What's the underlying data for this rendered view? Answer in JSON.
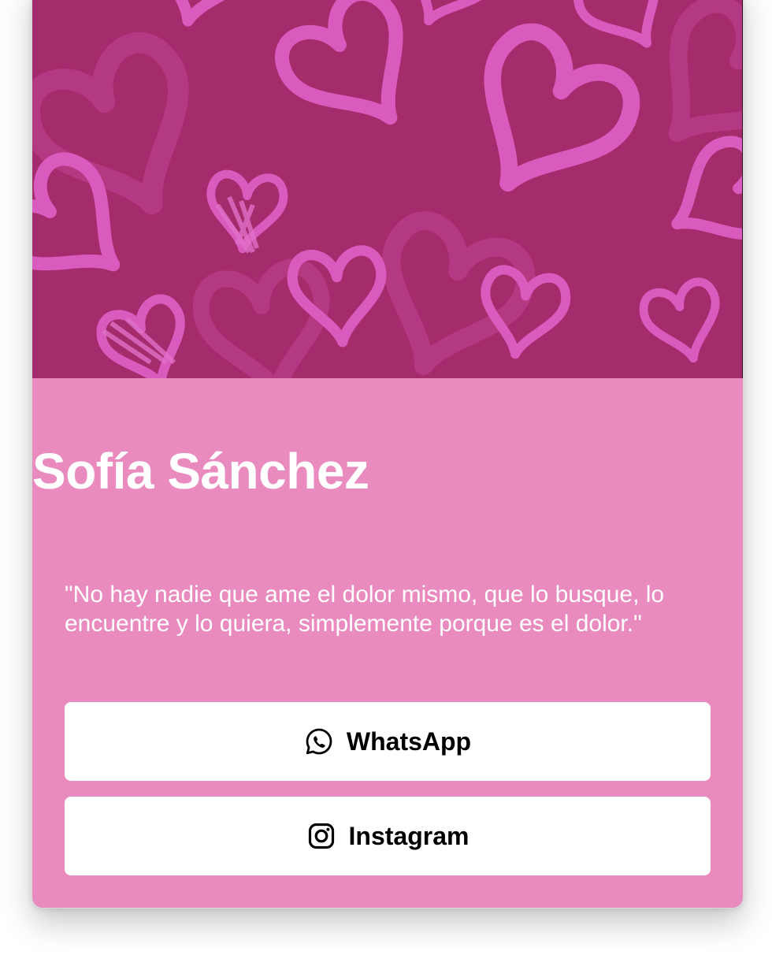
{
  "profile": {
    "name": "Sofía Sánchez",
    "quote": "\"No hay nadie que ame el dolor mismo, que lo busque, lo encuentre y lo quiera, simplemente porque es el dolor.\""
  },
  "links": {
    "whatsapp": {
      "label": "WhatsApp",
      "icon": "whatsapp-icon"
    },
    "instagram": {
      "label": "Instagram",
      "icon": "instagram-icon"
    }
  },
  "colors": {
    "card_background": "#ea8bbf",
    "banner_background": "#a42b6c",
    "banner_hearts": "#d95bbd",
    "button_background": "#ffffff",
    "text_light": "#ffffff",
    "text_dark": "#000000"
  }
}
